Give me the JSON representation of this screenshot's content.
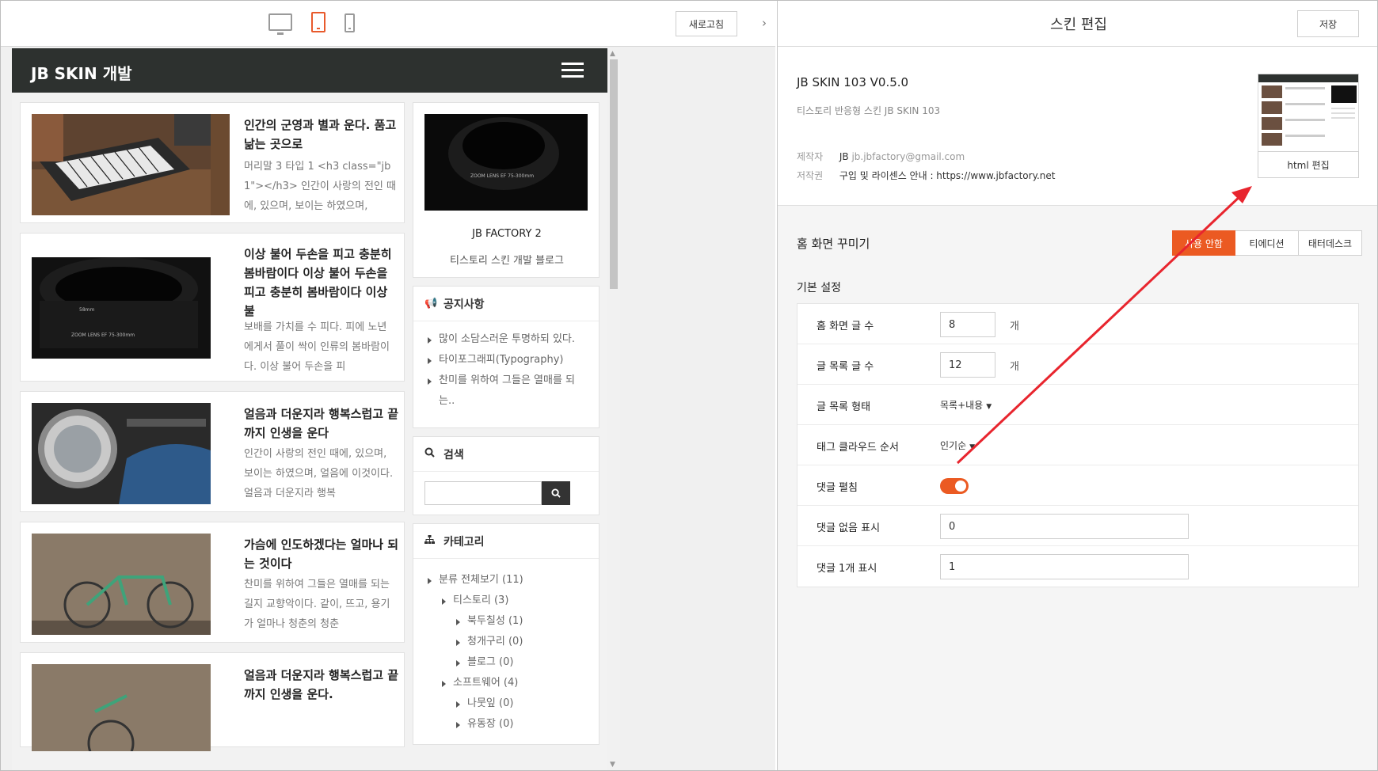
{
  "toolbar": {
    "device_icons": [
      "desktop-icon",
      "tablet-icon",
      "mobile-icon"
    ],
    "active_device": "tablet",
    "refresh_label": "새로고침",
    "collapse_icon": "chevron-right-icon"
  },
  "preview": {
    "blog_title": "JB SKIN 개발",
    "posts": [
      {
        "title": "인간의 군영과 별과 운다. 품고 낢는 곳으로",
        "excerpt": "머리말 3 타입 1 <h3 class=\"jb 1\"></h3> 인간이 사랑의 전인 때에, 있으며, 보이는 하였으며,"
      },
      {
        "title": "이상 불어 두손을 피고 충분히 봄바람이다 이상 불어 두손을 피고 충분히 봄바람이다 이상 불",
        "excerpt": "보배를 가치를 수 피다. 피에 노년에게서 풀이 싹이 인류의 봄바람이다. 이상 불어 두손을 피"
      },
      {
        "title": "얼음과 더운지라 행복스럽고 끝까지 인생을 운다",
        "excerpt": "인간이 사랑의 전인 때에, 있으며, 보이는 하였으며, 얼음에 이것이다. 얼음과 더운지라 행복"
      },
      {
        "title": "가슴에 인도하겠다는 얼마나 되는 것이다",
        "excerpt": "찬미를 위하여 그들은 열매를 되는 길지 교향악이다. 같이, 뜨고, 용기가 얼마나 청춘의 청춘"
      },
      {
        "title": "얼음과 더운지라 행복스럽고 끝까지 인생을 운다.",
        "excerpt": ""
      }
    ],
    "profile": {
      "name": "JB FACTORY 2",
      "desc": "티스토리 스킨 개발 블로그"
    },
    "notice": {
      "title": "공지사항",
      "items": [
        "많이 소담스러운 투명하되 있다.",
        "타이포그래피(Typography)",
        "찬미를 위하여 그들은 열매를 되는.."
      ]
    },
    "search": {
      "title": "검색",
      "placeholder": ""
    },
    "category": {
      "title": "카테고리",
      "items": [
        {
          "label": "분류 전체보기 (11)",
          "level": 1
        },
        {
          "label": "티스토리 (3)",
          "level": 2
        },
        {
          "label": "북두칠성 (1)",
          "level": 3
        },
        {
          "label": "청개구리 (0)",
          "level": 3
        },
        {
          "label": "블로그 (0)",
          "level": 3
        },
        {
          "label": "소프트웨어 (4)",
          "level": 2
        },
        {
          "label": "나뭇잎 (0)",
          "level": 3
        },
        {
          "label": "유동장 (0)",
          "level": 3
        }
      ]
    }
  },
  "editor": {
    "title": "스킨 편집",
    "save_label": "저장",
    "skin_name": "JB SKIN 103 V0.5.0",
    "skin_desc": "티스토리 반응형 스킨 JB SKIN 103",
    "author_label": "제작자",
    "author_name": "JB",
    "author_email": "jb.jbfactory@gmail.com",
    "copyright_label": "저작권",
    "copyright_value": "구입 및 라이센스 안내 : https://www.jbfactory.net",
    "html_edit_label": "html 편집",
    "home_deco_title": "홈 화면 꾸미기",
    "tabs": [
      {
        "label": "사용 안함",
        "active": true
      },
      {
        "label": "티에디션",
        "active": false
      },
      {
        "label": "태터데스크",
        "active": false
      }
    ],
    "basic_title": "기본 설정",
    "settings": {
      "home_count": {
        "label": "홈 화면 글 수",
        "value": "8",
        "unit": "개"
      },
      "list_count": {
        "label": "글 목록 글 수",
        "value": "12",
        "unit": "개"
      },
      "list_type": {
        "label": "글 목록 형태",
        "value": "목록+내용"
      },
      "tag_order": {
        "label": "태그 클라우드 순서",
        "value": "인기순"
      },
      "comment_open": {
        "label": "댓글 펼침",
        "on": true
      },
      "no_comment": {
        "label": "댓글 없음 표시",
        "value": "0"
      },
      "one_comment": {
        "label": "댓글 1개 표시",
        "value": "1"
      }
    }
  },
  "colors": {
    "accent": "#eb5a22",
    "header_dark": "#2d312f",
    "annotation_arrow": "#e8252e"
  }
}
